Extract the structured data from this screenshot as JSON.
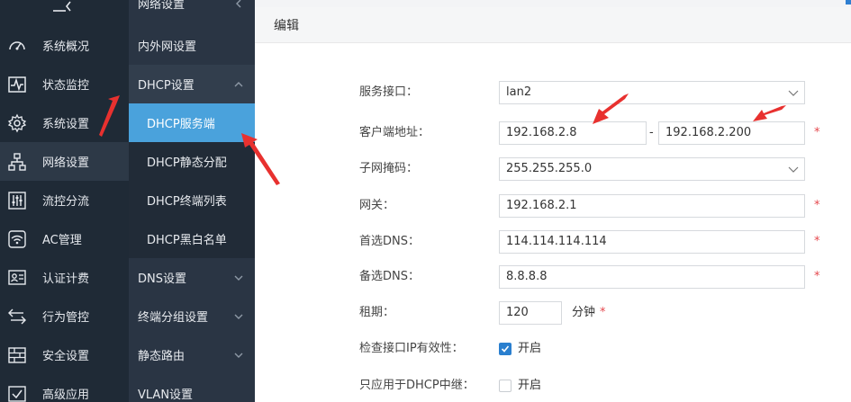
{
  "sidebar_primary": {
    "items": [
      {
        "label": "系统概况",
        "icon": "dashboard-icon"
      },
      {
        "label": "状态监控",
        "icon": "monitor-icon"
      },
      {
        "label": "系统设置",
        "icon": "gear-icon"
      },
      {
        "label": "网络设置",
        "icon": "network-icon"
      },
      {
        "label": "流控分流",
        "icon": "sliders-icon"
      },
      {
        "label": "AC管理",
        "icon": "wifi-icon"
      },
      {
        "label": "认证计费",
        "icon": "id-card-icon"
      },
      {
        "label": "行为管控",
        "icon": "arrows-icon"
      },
      {
        "label": "安全设置",
        "icon": "firewall-icon"
      },
      {
        "label": "高级应用",
        "icon": "checkbox-icon"
      }
    ]
  },
  "sidebar_secondary": {
    "header": "网络设置",
    "items": [
      {
        "label": "内外网设置"
      },
      {
        "label": "DHCP设置"
      },
      {
        "label": "DHCP服务端"
      },
      {
        "label": "DHCP静态分配"
      },
      {
        "label": "DHCP终端列表"
      },
      {
        "label": "DHCP黑白名单"
      },
      {
        "label": "DNS设置"
      },
      {
        "label": "终端分组设置"
      },
      {
        "label": "静态路由"
      },
      {
        "label": "VLAN设置"
      }
    ]
  },
  "panel": {
    "title": "编辑",
    "service_interface": {
      "label": "服务接口：",
      "value": "lan2"
    },
    "client_address": {
      "label": "客户端地址：",
      "start": "192.168.2.8",
      "separator": "-",
      "end": "192.168.2.200",
      "required": "*"
    },
    "subnet_mask": {
      "label": "子网掩码：",
      "value": "255.255.255.0"
    },
    "gateway": {
      "label": "网关：",
      "value": "192.168.2.1",
      "required": "*"
    },
    "primary_dns": {
      "label": "首选DNS：",
      "value": "114.114.114.114",
      "required": "*"
    },
    "secondary_dns": {
      "label": "备选DNS：",
      "value": "8.8.8.8",
      "required": "*"
    },
    "lease": {
      "label": "租期：",
      "value": "120",
      "unit": "分钟",
      "required": "*"
    },
    "check_ip": {
      "label": "检查接口IP有效性：",
      "option": "开启",
      "checked": true
    },
    "dhcp_relay_only": {
      "label": "只应用于DHCP中继：",
      "option": "开启",
      "checked": false
    }
  },
  "colors": {
    "sidebar_primary_bg": "#1f2a36",
    "sidebar_secondary_bg": "#2a3544",
    "selected_bg": "#4aa2dc",
    "required": "#e5484d",
    "annotation_arrow": "#e8312f"
  }
}
